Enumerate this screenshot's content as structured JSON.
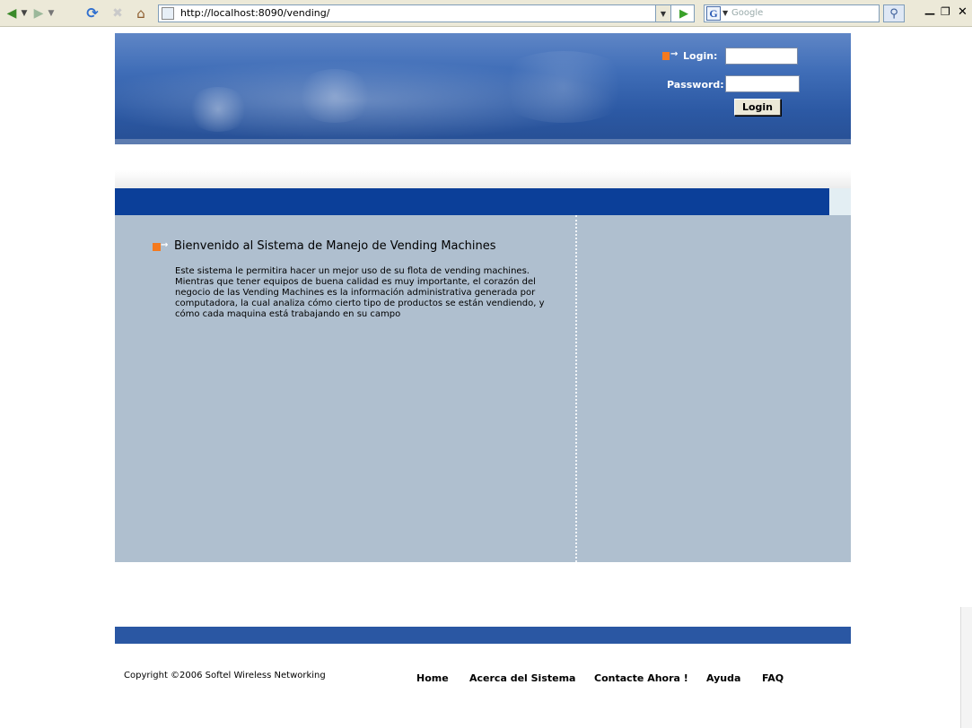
{
  "browser": {
    "url": "http://localhost:8090/vending/",
    "search_placeholder": "Google",
    "search_engine_letter": "G"
  },
  "icons": {
    "back": "back-arrow-icon",
    "forward": "forward-arrow-icon",
    "refresh": "refresh-icon",
    "stop": "stop-icon",
    "home": "home-icon",
    "go": "go-icon",
    "search": "magnifier-icon"
  },
  "header": {
    "login_label": "Login:",
    "password_label": "Password:",
    "login_button": "Login"
  },
  "main": {
    "welcome_title": "Bienvenido al Sistema de Manejo de Vending Machines",
    "welcome_lines": [
      "Este sistema le permitira hacer un mejor uso de su flota de vending machines.",
      "Mientras que tener equipos de buena calidad es muy importante, el corazón del",
      "negocio de las Vending Machines es la información administrativa generada por",
      "computadora, la cual analiza cómo cierto tipo de productos se están vendiendo, y",
      "cómo cada maquina está trabajando en su campo"
    ]
  },
  "footer": {
    "copyright": "Copyright ©2006 Softel Wireless Networking",
    "nav": [
      "Home",
      "Acerca del Sistema",
      "Contacte Ahora !",
      "Ayuda",
      "FAQ"
    ]
  },
  "colors": {
    "banner": "#2c59a4",
    "accent_orange": "#f47a1f",
    "nav_blue": "#0b3f99",
    "content_bg": "#afbfcf",
    "footer_bar": "#2a57a3"
  }
}
